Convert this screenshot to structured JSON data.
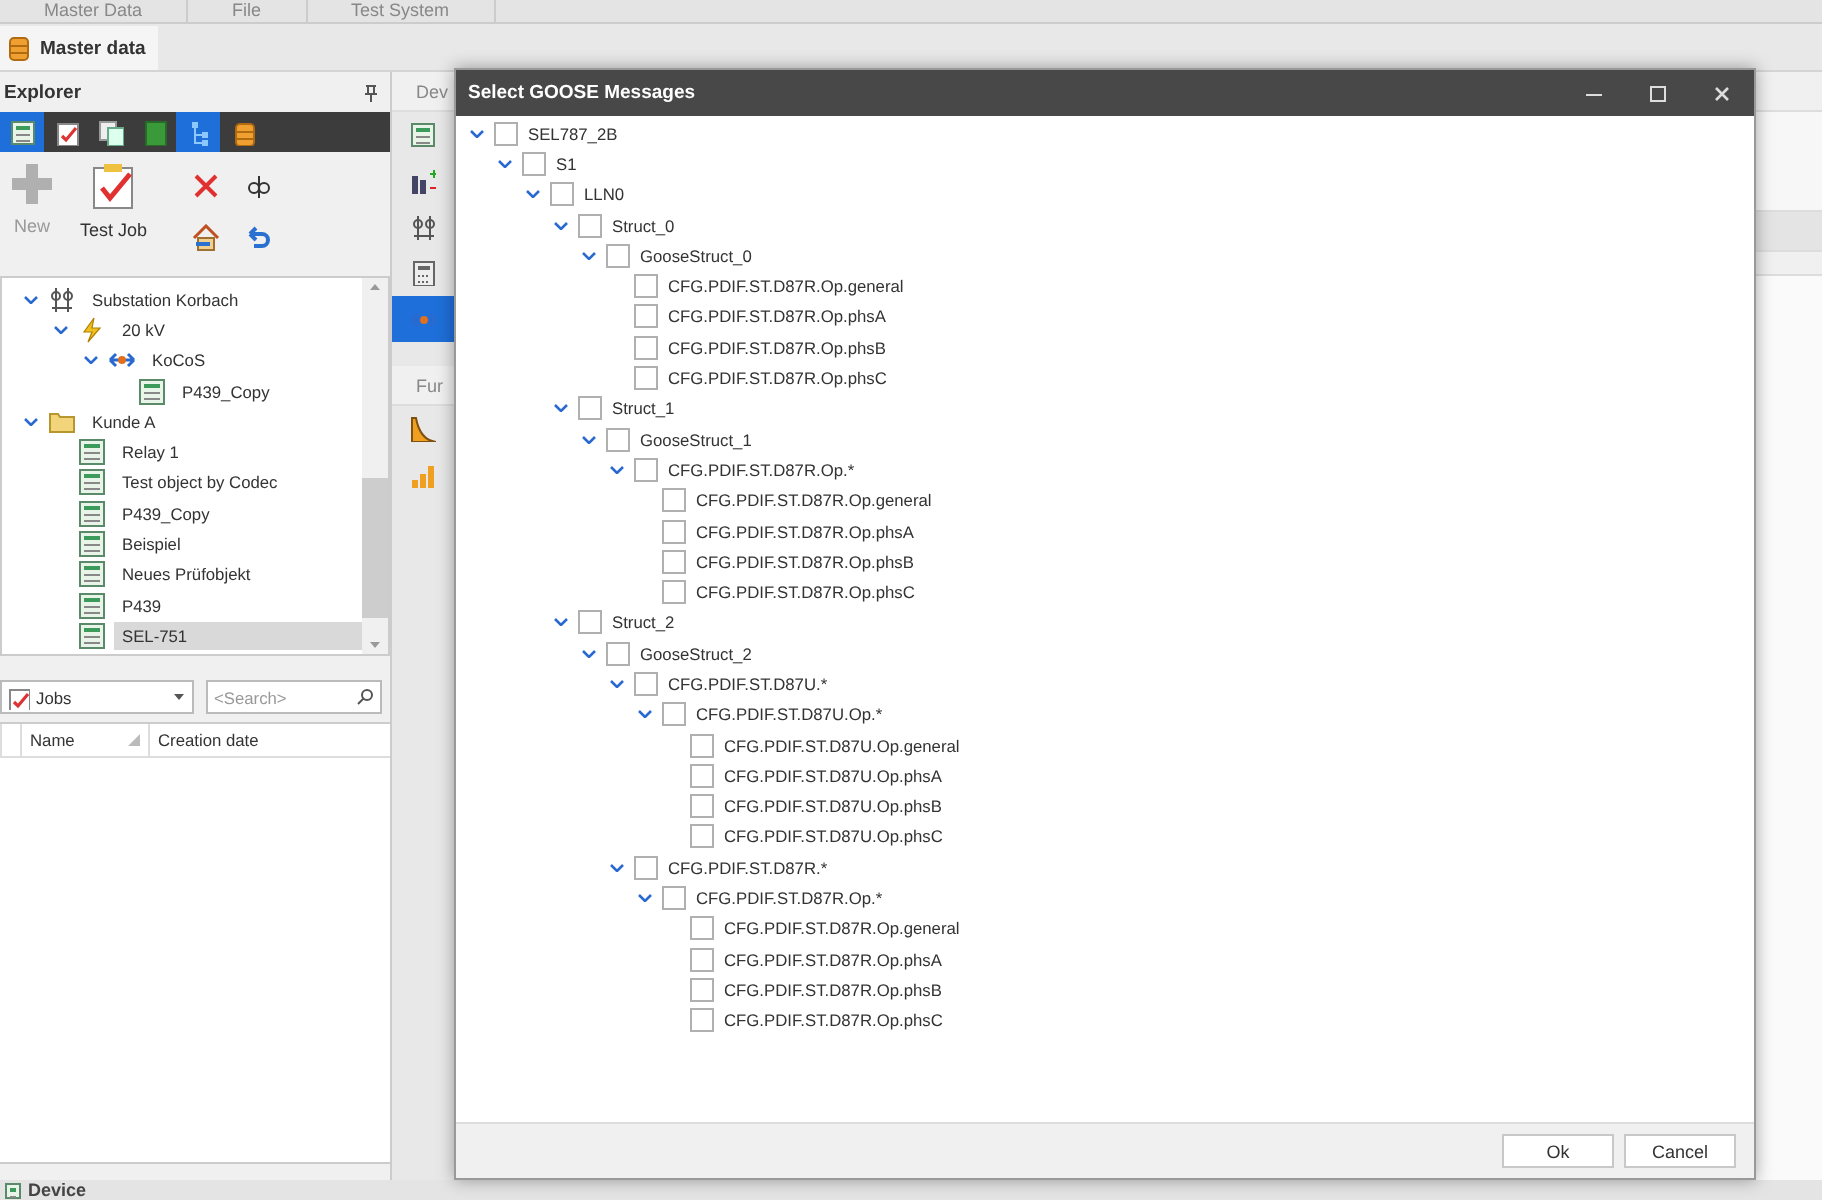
{
  "menu_tabs": [
    {
      "label": "Master Data"
    },
    {
      "label": "File"
    },
    {
      "label": "Test System"
    }
  ],
  "ribbon_tab": {
    "label": "Master data"
  },
  "explorer": {
    "title": "Explorer",
    "toolbar": [
      {
        "kind": "form",
        "selected": true
      },
      {
        "kind": "clipboard",
        "selected": false
      },
      {
        "kind": "copy",
        "selected": false
      },
      {
        "kind": "book",
        "selected": false
      },
      {
        "kind": "tree",
        "selected": true
      },
      {
        "kind": "database",
        "selected": false
      }
    ],
    "actions": [
      {
        "kind": "new",
        "label": "New",
        "disabled": true
      },
      {
        "kind": "testjob",
        "label": "Test Job",
        "disabled": false
      }
    ],
    "tools": [
      {
        "kind": "delete"
      },
      {
        "kind": "spell"
      },
      {
        "kind": "home"
      },
      {
        "kind": "undo"
      }
    ],
    "tree": [
      {
        "label": "Substation Korbach",
        "kind": "substation",
        "expanded": true,
        "selected": false,
        "children": [
          {
            "label": "20 kV",
            "kind": "voltage",
            "expanded": true,
            "selected": false,
            "children": [
              {
                "label": "KoCoS",
                "kind": "bay",
                "expanded": true,
                "selected": false,
                "children": [
                  {
                    "label": "P439_Copy",
                    "kind": "device",
                    "selected": false
                  }
                ]
              }
            ]
          }
        ]
      },
      {
        "label": "Kunde A",
        "kind": "folder",
        "expanded": true,
        "selected": false,
        "children": [
          {
            "label": "Relay 1",
            "kind": "device",
            "selected": false
          },
          {
            "label": "Test object by Codec",
            "kind": "device",
            "selected": false
          },
          {
            "label": "P439_Copy",
            "kind": "device",
            "selected": false
          },
          {
            "label": "Beispiel",
            "kind": "device",
            "selected": false
          },
          {
            "label": "Neues Prüfobjekt",
            "kind": "device",
            "selected": false
          },
          {
            "label": "P439",
            "kind": "device",
            "selected": false
          },
          {
            "label": "SEL-751",
            "kind": "device",
            "selected": true
          }
        ]
      }
    ],
    "jobs_dropdown": {
      "value": "Jobs"
    },
    "search": {
      "placeholder": "<Search>"
    },
    "columns": [
      {
        "label": "Name"
      },
      {
        "label": "Creation date"
      }
    ]
  },
  "side_strip": [
    {
      "header": "Dev",
      "items": [
        {
          "kind": "device",
          "selected": false
        },
        {
          "kind": "chart",
          "selected": false
        },
        {
          "kind": "substation",
          "selected": false
        },
        {
          "kind": "calculator",
          "selected": false
        },
        {
          "kind": "bay",
          "selected": true
        }
      ]
    },
    {
      "header": "Fur",
      "items": [
        {
          "kind": "curve",
          "selected": false
        },
        {
          "kind": "bars",
          "selected": false
        }
      ]
    }
  ],
  "dialog": {
    "title": "Select GOOSE Messages",
    "tree": [
      {
        "label": "SEL787_2B",
        "checked": false,
        "expanded": true,
        "children": [
          {
            "label": "S1",
            "checked": false,
            "expanded": true,
            "children": [
              {
                "label": "LLN0",
                "checked": false,
                "expanded": true,
                "children": [
                  {
                    "label": "Struct_0",
                    "checked": false,
                    "expanded": true,
                    "children": [
                      {
                        "label": "GooseStruct_0",
                        "checked": false,
                        "expanded": true,
                        "children": [
                          {
                            "label": "CFG.PDIF.ST.D87R.Op.general",
                            "checked": false
                          },
                          {
                            "label": "CFG.PDIF.ST.D87R.Op.phsA",
                            "checked": false
                          },
                          {
                            "label": "CFG.PDIF.ST.D87R.Op.phsB",
                            "checked": false
                          },
                          {
                            "label": "CFG.PDIF.ST.D87R.Op.phsC",
                            "checked": false
                          }
                        ]
                      }
                    ]
                  },
                  {
                    "label": "Struct_1",
                    "checked": false,
                    "expanded": true,
                    "children": [
                      {
                        "label": "GooseStruct_1",
                        "checked": false,
                        "expanded": true,
                        "children": [
                          {
                            "label": "CFG.PDIF.ST.D87R.Op.*",
                            "checked": false,
                            "expanded": true,
                            "children": [
                              {
                                "label": "CFG.PDIF.ST.D87R.Op.general",
                                "checked": false
                              },
                              {
                                "label": "CFG.PDIF.ST.D87R.Op.phsA",
                                "checked": false
                              },
                              {
                                "label": "CFG.PDIF.ST.D87R.Op.phsB",
                                "checked": false
                              },
                              {
                                "label": "CFG.PDIF.ST.D87R.Op.phsC",
                                "checked": false
                              }
                            ]
                          }
                        ]
                      }
                    ]
                  },
                  {
                    "label": "Struct_2",
                    "checked": false,
                    "expanded": true,
                    "children": [
                      {
                        "label": "GooseStruct_2",
                        "checked": false,
                        "expanded": true,
                        "children": [
                          {
                            "label": "CFG.PDIF.ST.D87U.*",
                            "checked": false,
                            "expanded": true,
                            "children": [
                              {
                                "label": "CFG.PDIF.ST.D87U.Op.*",
                                "checked": false,
                                "expanded": true,
                                "children": [
                                  {
                                    "label": "CFG.PDIF.ST.D87U.Op.general",
                                    "checked": false
                                  },
                                  {
                                    "label": "CFG.PDIF.ST.D87U.Op.phsA",
                                    "checked": false
                                  },
                                  {
                                    "label": "CFG.PDIF.ST.D87U.Op.phsB",
                                    "checked": false
                                  },
                                  {
                                    "label": "CFG.PDIF.ST.D87U.Op.phsC",
                                    "checked": false
                                  }
                                ]
                              }
                            ]
                          },
                          {
                            "label": "CFG.PDIF.ST.D87R.*",
                            "checked": false,
                            "expanded": true,
                            "children": [
                              {
                                "label": "CFG.PDIF.ST.D87R.Op.*",
                                "checked": false,
                                "expanded": true,
                                "children": [
                                  {
                                    "label": "CFG.PDIF.ST.D87R.Op.general",
                                    "checked": false
                                  },
                                  {
                                    "label": "CFG.PDIF.ST.D87R.Op.phsA",
                                    "checked": false
                                  },
                                  {
                                    "label": "CFG.PDIF.ST.D87R.Op.phsB",
                                    "checked": false
                                  },
                                  {
                                    "label": "CFG.PDIF.ST.D87R.Op.phsC",
                                    "checked": false
                                  }
                                ]
                              }
                            ]
                          }
                        ]
                      }
                    ]
                  }
                ]
              }
            ]
          }
        ]
      }
    ],
    "buttons": [
      {
        "label": "Ok"
      },
      {
        "label": "Cancel"
      }
    ]
  },
  "status_bar": {
    "label": "Device"
  }
}
